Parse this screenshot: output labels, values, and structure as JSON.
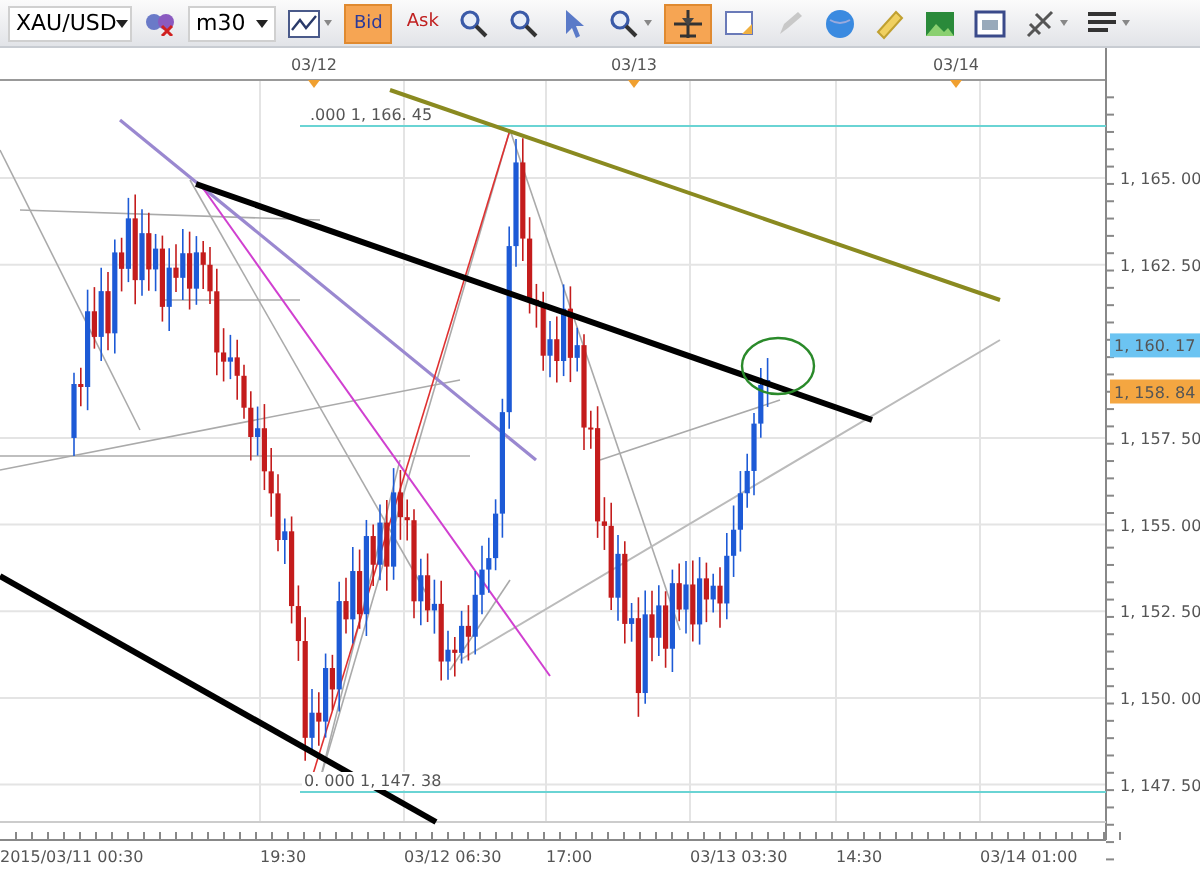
{
  "toolbar": {
    "symbol": "XAU/USD",
    "timeframe": "m30",
    "price_buttons": [
      {
        "label": "Bid",
        "selected": true
      },
      {
        "label": "Ask",
        "selected": false
      }
    ],
    "tools": [
      {
        "selected": false
      },
      {
        "selected": false
      },
      {
        "selected": false
      },
      {
        "selected": false
      },
      {
        "selected": true
      },
      {
        "selected": false
      },
      {
        "selected": false
      },
      {
        "selected": false
      },
      {
        "selected": false
      },
      {
        "selected": false
      },
      {
        "selected": false
      },
      {
        "selected": false
      },
      {
        "selected": false
      }
    ]
  },
  "chart": {
    "top_dates": [
      "03/12",
      "03/13",
      "03/14"
    ],
    "price_labels": [
      "1, 165. 00",
      "1, 162. 50",
      "1, 157. 50",
      "1, 155. 00",
      "1, 152. 50",
      "1, 150. 00",
      "1, 147. 50"
    ],
    "price_tags": [
      {
        "text": "1, 160. 17",
        "color": "#6cc4f2"
      },
      {
        "text": "1, 158. 84",
        "color": "#f4a641"
      }
    ],
    "time_labels": [
      "2015/03/11 00:30",
      "19:30",
      "03/12 06:30",
      "17:00",
      "03/13 03:30",
      "14:30",
      "03/14 01:00"
    ],
    "fib_labels": [
      ".000 1, 166. 45",
      "0. 000 1, 147. 38"
    ]
  }
}
